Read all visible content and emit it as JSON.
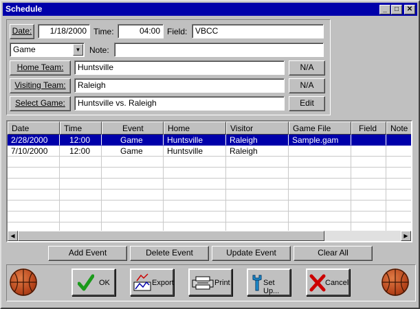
{
  "window": {
    "title": "Schedule",
    "controls": {
      "minimize": "_",
      "maximize": "□",
      "close": "✕"
    }
  },
  "form": {
    "date_button": "Date:",
    "date_value": "1/18/2000",
    "time_label": "Time:",
    "time_value": "04:00",
    "field_label": "Field:",
    "field_value": "VBCC",
    "event_type": "Game",
    "note_label": "Note:",
    "note_value": "",
    "home_team_button": "Home Team:",
    "home_team_value": "Huntsville",
    "home_na_button": "N/A",
    "visiting_team_button": "Visiting Team:",
    "visiting_team_value": "Raleigh",
    "visiting_na_button": "N/A",
    "select_game_button": "Select Game:",
    "select_game_value": "Huntsville vs. Raleigh",
    "edit_button": "Edit"
  },
  "table": {
    "headers": [
      "Date",
      "Time",
      "Event",
      "Home",
      "Visitor",
      "Game File",
      "Field",
      "Note"
    ],
    "rows": [
      [
        "2/28/2000",
        "12:00",
        "Game",
        "Huntsville",
        "Raleigh",
        "Sample.gam",
        "",
        ""
      ],
      [
        "7/10/2000",
        "12:00",
        "Game",
        "Huntsville",
        "Raleigh",
        "",
        "",
        ""
      ]
    ],
    "selected_row": 0
  },
  "actions": {
    "add_event": "Add Event",
    "delete_event": "Delete Event",
    "update_event": "Update Event",
    "clear_all": "Clear All"
  },
  "toolbar": {
    "ok": "OK",
    "export": "Export",
    "print": "Print",
    "setup": "Set Up...",
    "cancel": "Cancel"
  },
  "colors": {
    "titlebar": "#0000aa",
    "selection": "#0000aa",
    "face": "#c0c0c0",
    "ok_check": "#1a9a1a",
    "cancel_x": "#cc0000"
  },
  "icons": [
    "basketball-icon",
    "check-icon",
    "export-icon",
    "printer-icon",
    "wrench-icon",
    "cancel-x-icon"
  ]
}
